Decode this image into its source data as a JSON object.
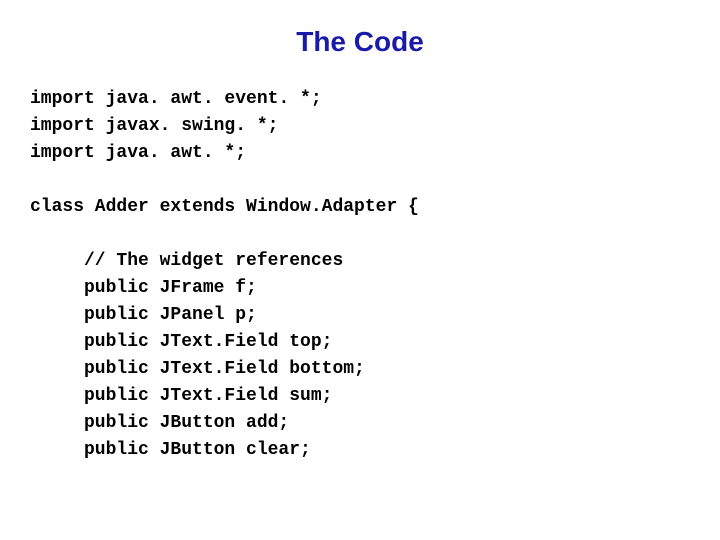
{
  "title": "The Code",
  "code": {
    "imports": [
      "import java. awt. event. *;",
      "import javax. swing. *;",
      "import java. awt. *;"
    ],
    "classDecl": "class Adder extends Window.Adapter {",
    "body": [
      "// The widget references",
      "public JFrame f;",
      "public JPanel p;",
      "public JText.Field top;",
      "public JText.Field bottom;",
      "public JText.Field sum;",
      "public JButton add;",
      "public JButton clear;"
    ]
  }
}
